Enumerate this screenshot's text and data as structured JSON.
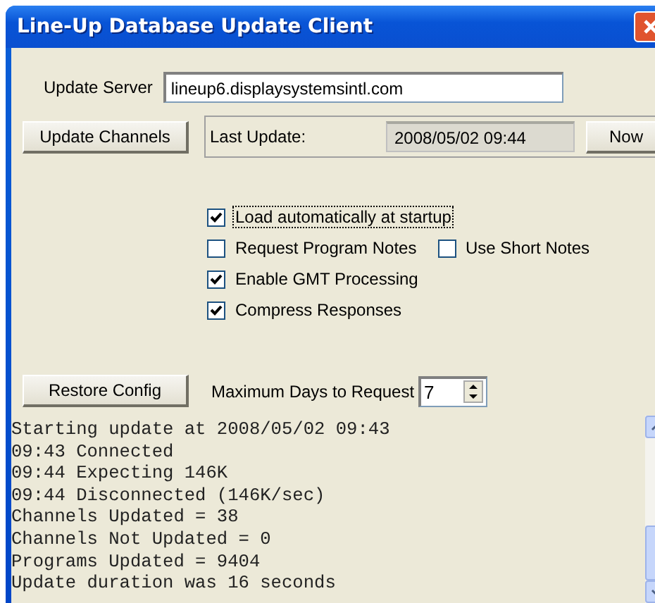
{
  "window": {
    "title": "Line-Up Database Update Client"
  },
  "server": {
    "label": "Update Server",
    "value": "lineup6.displaysystemsintl.com"
  },
  "update_button": "Update Channels",
  "last_update": {
    "label": "Last Update:",
    "value": "2008/05/02 09:44",
    "now_button": "Now"
  },
  "option_rows": [
    [
      {
        "label": "Load automatically at startup",
        "checked": true,
        "focused": true
      }
    ],
    [
      {
        "label": "Request Program Notes",
        "checked": false,
        "focused": false
      },
      {
        "label": "Use Short Notes",
        "checked": false,
        "focused": false
      }
    ],
    [
      {
        "label": "Enable GMT Processing",
        "checked": true,
        "focused": false
      }
    ],
    [
      {
        "label": "Compress Responses",
        "checked": true,
        "focused": false
      }
    ]
  ],
  "restore_button": "Restore Config",
  "max_days": {
    "label": "Maximum Days to Request",
    "value": "7"
  },
  "log": [
    "Starting update at 2008/05/02 09:43",
    "09:43 Connected",
    "09:44 Expecting 146K",
    "09:44 Disconnected (146K/sec)",
    "Channels Updated = 38",
    "Channels Not Updated = 0",
    "Programs Updated = 9404",
    "Update duration was 16 seconds"
  ]
}
